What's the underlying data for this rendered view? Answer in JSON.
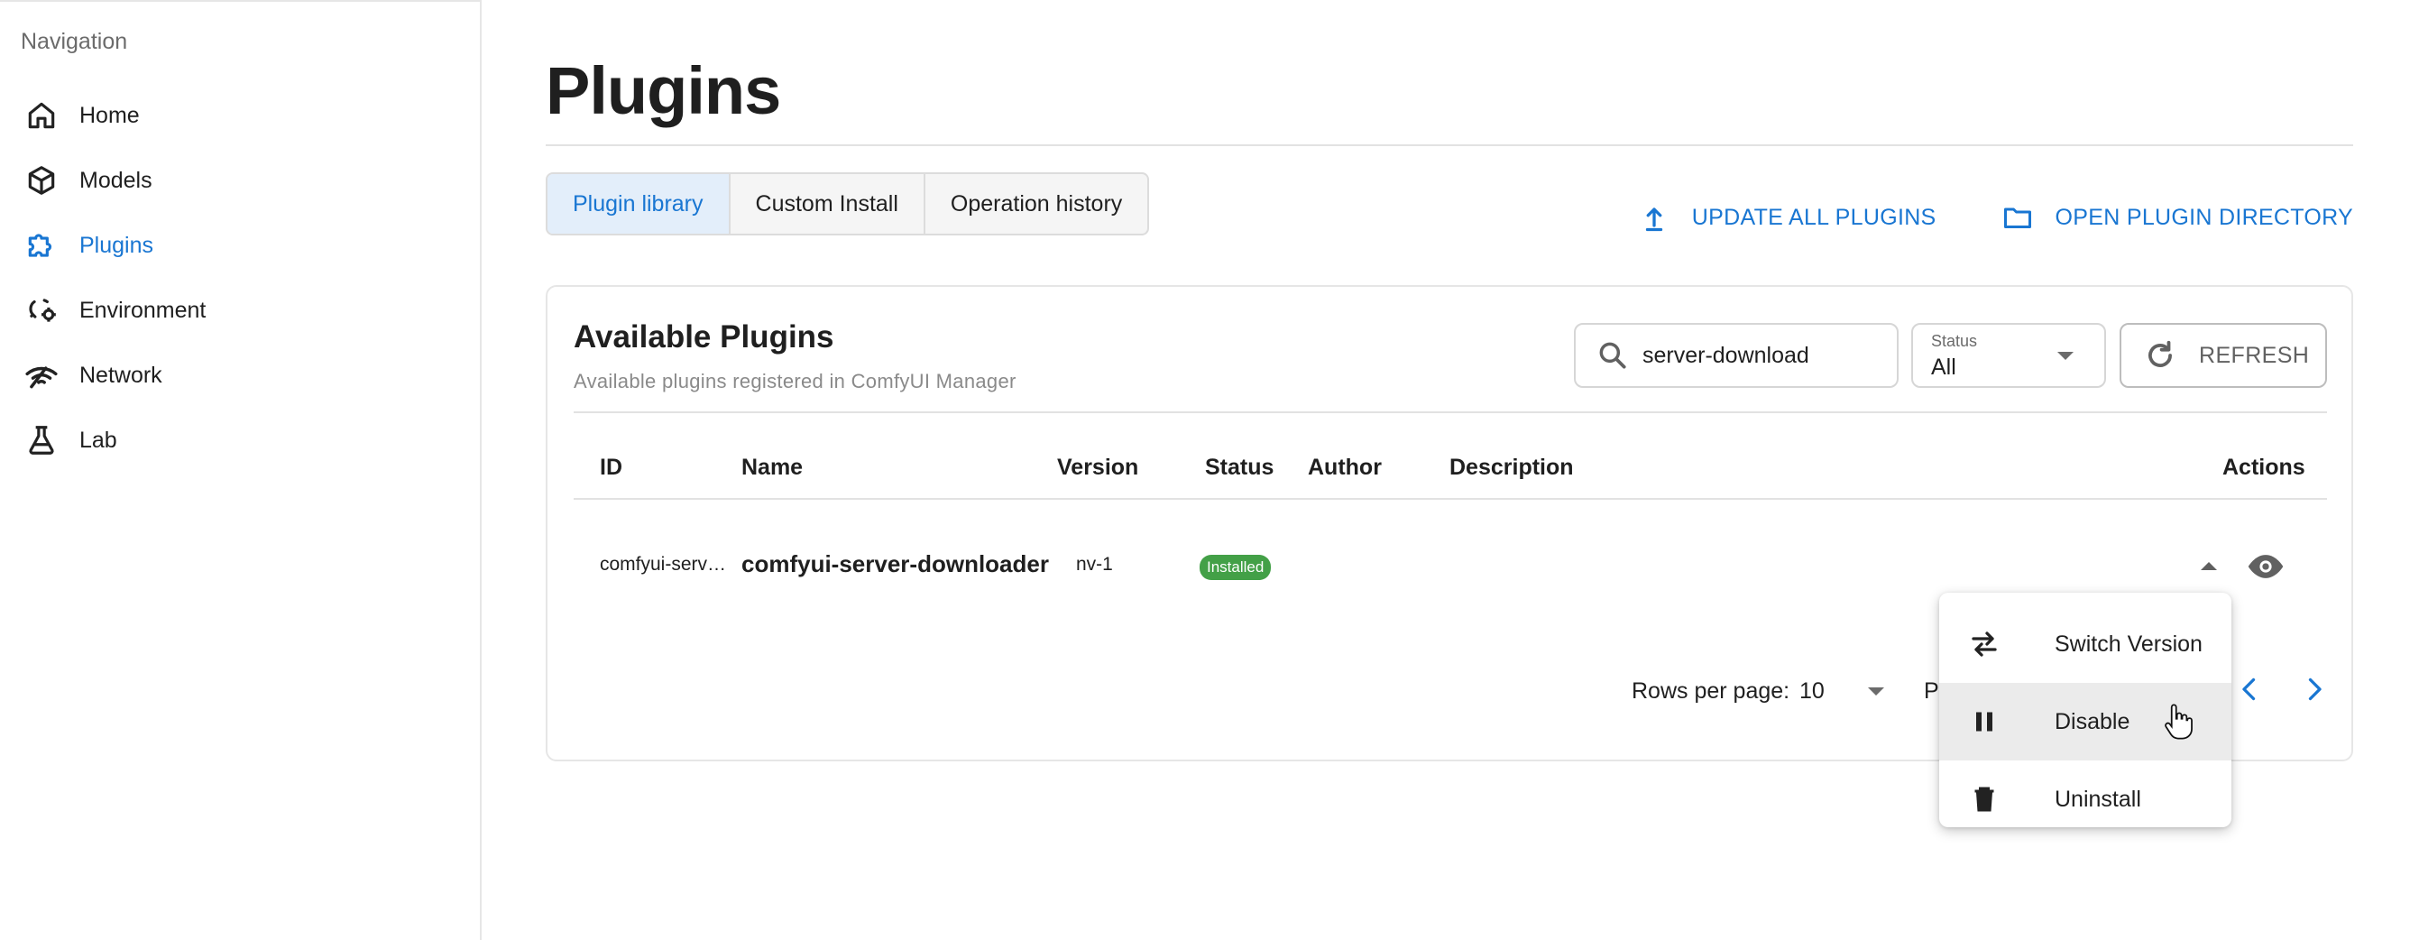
{
  "sidebar": {
    "heading": "Navigation",
    "items": [
      {
        "label": "Home",
        "icon": "home-icon",
        "active": false
      },
      {
        "label": "Models",
        "icon": "cube-icon",
        "active": false
      },
      {
        "label": "Plugins",
        "icon": "puzzle-icon",
        "active": true
      },
      {
        "label": "Environment",
        "icon": "environment-icon",
        "active": false
      },
      {
        "label": "Network",
        "icon": "network-icon",
        "active": false
      },
      {
        "label": "Lab",
        "icon": "flask-icon",
        "active": false
      }
    ]
  },
  "page": {
    "title": "Plugins",
    "tabs": [
      {
        "label": "Plugin library",
        "active": true
      },
      {
        "label": "Custom Install",
        "active": false
      },
      {
        "label": "Operation history",
        "active": false
      }
    ],
    "actions": {
      "update_all": "UPDATE ALL PLUGINS",
      "open_dir": "OPEN PLUGIN DIRECTORY"
    }
  },
  "card": {
    "title": "Available Plugins",
    "subtitle": "Available plugins registered in ComfyUI Manager",
    "search": {
      "value": "server-download",
      "icon": "search-icon"
    },
    "status_filter": {
      "label": "Status",
      "value": "All"
    },
    "refresh_label": "REFRESH"
  },
  "table": {
    "columns": [
      "ID",
      "Name",
      "Version",
      "Status",
      "Author",
      "Description",
      "Actions"
    ],
    "rows": [
      {
        "id": "comfyui-serv…",
        "name": "comfyui-server-downloader",
        "version": "nv-1",
        "status": "Installed",
        "author": "",
        "description": ""
      }
    ]
  },
  "pagination": {
    "rows_per_page_label": "Rows per page:",
    "rows_per_page": "10",
    "page_label_partial": "Pa"
  },
  "menu": {
    "items": [
      {
        "label": "Switch Version",
        "icon": "swap-icon"
      },
      {
        "label": "Disable",
        "icon": "pause-icon"
      },
      {
        "label": "Uninstall",
        "icon": "trash-icon"
      }
    ]
  },
  "colors": {
    "accent": "#1976d2",
    "installed_badge": "#43a047",
    "active_tab_bg": "#e3eefa"
  }
}
